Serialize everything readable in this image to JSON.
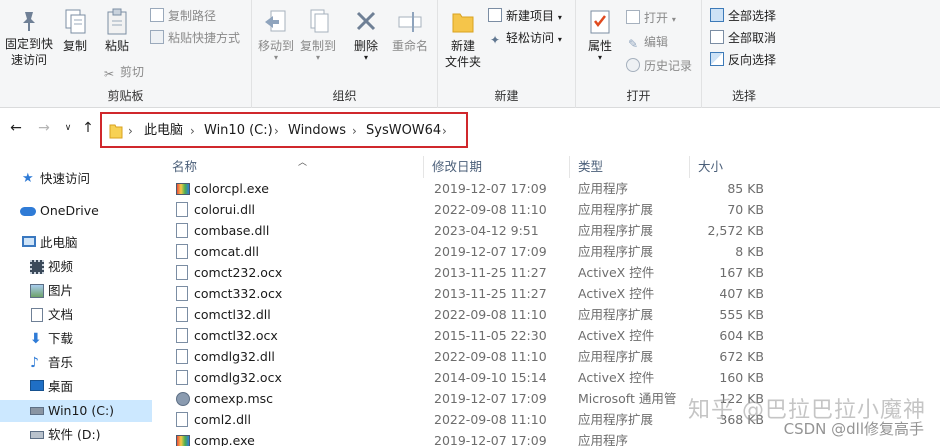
{
  "ribbon": {
    "clipboard": {
      "label": "剪贴板",
      "pin": "固定到快\n速访问",
      "copy": "复制",
      "paste": "粘贴",
      "copy_path": "复制路径",
      "paste_shortcut": "粘贴快捷方式",
      "cut": "剪切"
    },
    "organize": {
      "label": "组织",
      "move_to": "移动到",
      "copy_to": "复制到",
      "delete": "删除",
      "rename": "重命名"
    },
    "new": {
      "label": "新建",
      "new_folder": "新建\n文件夹",
      "new_item": "新建项目",
      "easy_access": "轻松访问"
    },
    "open": {
      "label": "打开",
      "properties": "属性",
      "open": "打开",
      "edit": "编辑",
      "history": "历史记录"
    },
    "select": {
      "label": "选择",
      "select_all": "全部选择",
      "select_none": "全部取消",
      "invert": "反向选择"
    }
  },
  "address": {
    "crumbs": [
      "此电脑",
      "Win10 (C:)",
      "Windows",
      "SysWOW64"
    ]
  },
  "sidebar": {
    "items": [
      {
        "label": "快速访问",
        "icon": "star-icon"
      },
      {
        "label": "OneDrive",
        "icon": "cloud-icon"
      },
      {
        "label": "此电脑",
        "icon": "computer-icon"
      },
      {
        "label": "视频",
        "icon": "video-icon"
      },
      {
        "label": "图片",
        "icon": "picture-icon"
      },
      {
        "label": "文档",
        "icon": "document-icon"
      },
      {
        "label": "下载",
        "icon": "download-icon"
      },
      {
        "label": "音乐",
        "icon": "music-icon"
      },
      {
        "label": "桌面",
        "icon": "desktop-icon"
      },
      {
        "label": "Win10 (C:)",
        "icon": "drive-icon"
      },
      {
        "label": "软件 (D:)",
        "icon": "drive-icon"
      }
    ]
  },
  "columns": {
    "name": "名称",
    "date": "修改日期",
    "type": "类型",
    "size": "大小"
  },
  "files": [
    {
      "name": "colorcpl.exe",
      "date": "2019-12-07 17:09",
      "type": "应用程序",
      "size": "85 KB",
      "icon": "exe-icon"
    },
    {
      "name": "colorui.dll",
      "date": "2022-09-08 11:10",
      "type": "应用程序扩展",
      "size": "70 KB",
      "icon": "dll-icon"
    },
    {
      "name": "combase.dll",
      "date": "2023-04-12 9:51",
      "type": "应用程序扩展",
      "size": "2,572 KB",
      "icon": "dll-icon"
    },
    {
      "name": "comcat.dll",
      "date": "2019-12-07 17:09",
      "type": "应用程序扩展",
      "size": "8 KB",
      "icon": "dll-icon"
    },
    {
      "name": "comct232.ocx",
      "date": "2013-11-25 11:27",
      "type": "ActiveX 控件",
      "size": "167 KB",
      "icon": "ocx-icon"
    },
    {
      "name": "comct332.ocx",
      "date": "2013-11-25 11:27",
      "type": "ActiveX 控件",
      "size": "407 KB",
      "icon": "ocx-icon"
    },
    {
      "name": "comctl32.dll",
      "date": "2022-09-08 11:10",
      "type": "应用程序扩展",
      "size": "555 KB",
      "icon": "dll-icon"
    },
    {
      "name": "comctl32.ocx",
      "date": "2015-11-05 22:30",
      "type": "ActiveX 控件",
      "size": "604 KB",
      "icon": "ocx-icon"
    },
    {
      "name": "comdlg32.dll",
      "date": "2022-09-08 11:10",
      "type": "应用程序扩展",
      "size": "672 KB",
      "icon": "dll-icon"
    },
    {
      "name": "comdlg32.ocx",
      "date": "2014-09-10 15:14",
      "type": "ActiveX 控件",
      "size": "160 KB",
      "icon": "ocx-icon"
    },
    {
      "name": "comexp.msc",
      "date": "2019-12-07 17:09",
      "type": "Microsoft 通用管",
      "size": "122 KB",
      "icon": "msc-icon"
    },
    {
      "name": "coml2.dll",
      "date": "2022-09-08 11:10",
      "type": "应用程序扩展",
      "size": "368 KB",
      "icon": "dll-icon"
    },
    {
      "name": "comp.exe",
      "date": "2019-12-07 17:09",
      "type": "应用程序",
      "size": "",
      "icon": "exe-icon"
    }
  ],
  "watermark": {
    "line1": "知乎 @巴拉巴拉小魔神",
    "line2": "CSDN @dll修复高手"
  }
}
